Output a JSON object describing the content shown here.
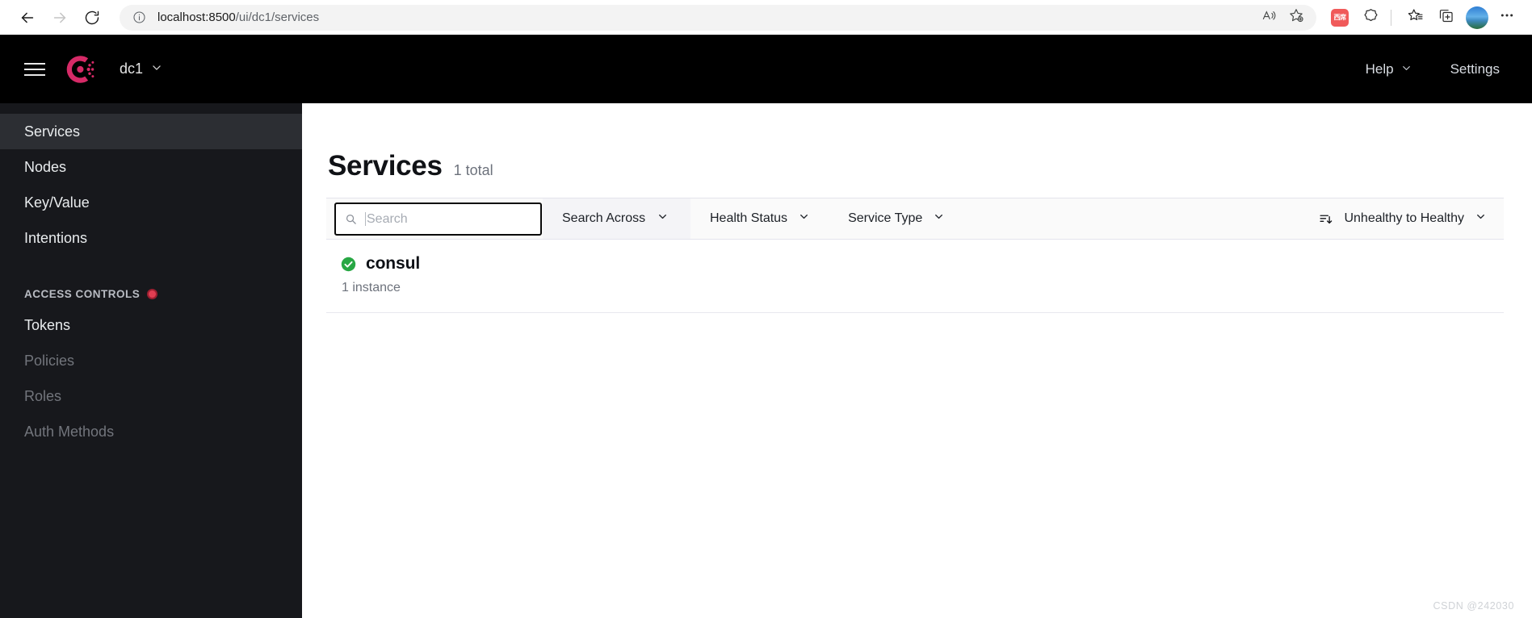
{
  "browser": {
    "back_icon": "back-arrow-icon",
    "forward_icon": "forward-arrow-icon",
    "reload_icon": "reload-icon",
    "info_icon": "site-info-icon",
    "url_host": "localhost:8500",
    "url_path": "/ui/dc1/services",
    "url_full": "localhost:8500/ui/dc1/services",
    "read_aloud_icon": "read-aloud-icon",
    "favorite_icon": "add-favorite-icon",
    "extension_badge_label": "西席",
    "collections_icon": "collections-icon",
    "favorites_bar_icon": "favorites-icon",
    "split_screen_icon": "split-screen-icon",
    "profile_icon": "profile-avatar",
    "settings_more_icon": "more-options-icon"
  },
  "topnav": {
    "menu_icon": "hamburger-menu-icon",
    "logo_icon": "consul-logo-icon",
    "datacenter": "dc1",
    "datacenter_chevron": "chevron-down-icon",
    "help_label": "Help",
    "help_chevron": "chevron-down-icon",
    "settings_label": "Settings",
    "brand_color": "#d62a67",
    "background": "#000000"
  },
  "sidebar": {
    "items": [
      {
        "label": "Services",
        "active": true,
        "dim": false
      },
      {
        "label": "Nodes",
        "active": false,
        "dim": false
      },
      {
        "label": "Key/Value",
        "active": false,
        "dim": false
      },
      {
        "label": "Intentions",
        "active": false,
        "dim": false
      }
    ],
    "group_label": "ACCESS CONTROLS",
    "group_badge_color": "#e03e52",
    "acl_items": [
      {
        "label": "Tokens",
        "dim": false
      },
      {
        "label": "Policies",
        "dim": true
      },
      {
        "label": "Roles",
        "dim": true
      },
      {
        "label": "Auth Methods",
        "dim": true
      }
    ]
  },
  "main": {
    "title": "Services",
    "count_label": "1 total",
    "search": {
      "placeholder": "Search",
      "value": "",
      "icon": "search-icon"
    },
    "search_across": {
      "label": "Search Across",
      "chevron": "chevron-down-icon"
    },
    "filters": [
      {
        "label": "Health Status",
        "chevron": "chevron-down-icon"
      },
      {
        "label": "Service Type",
        "chevron": "chevron-down-icon"
      }
    ],
    "sort": {
      "icon": "sort-descending-icon",
      "label": "Unhealthy to Healthy",
      "chevron": "chevron-down-icon"
    },
    "services": [
      {
        "name": "consul",
        "instances": "1 instance",
        "health": "passing",
        "health_icon": "check-circle-icon",
        "health_color": "#28a744"
      }
    ]
  },
  "watermark": "CSDN @242030"
}
